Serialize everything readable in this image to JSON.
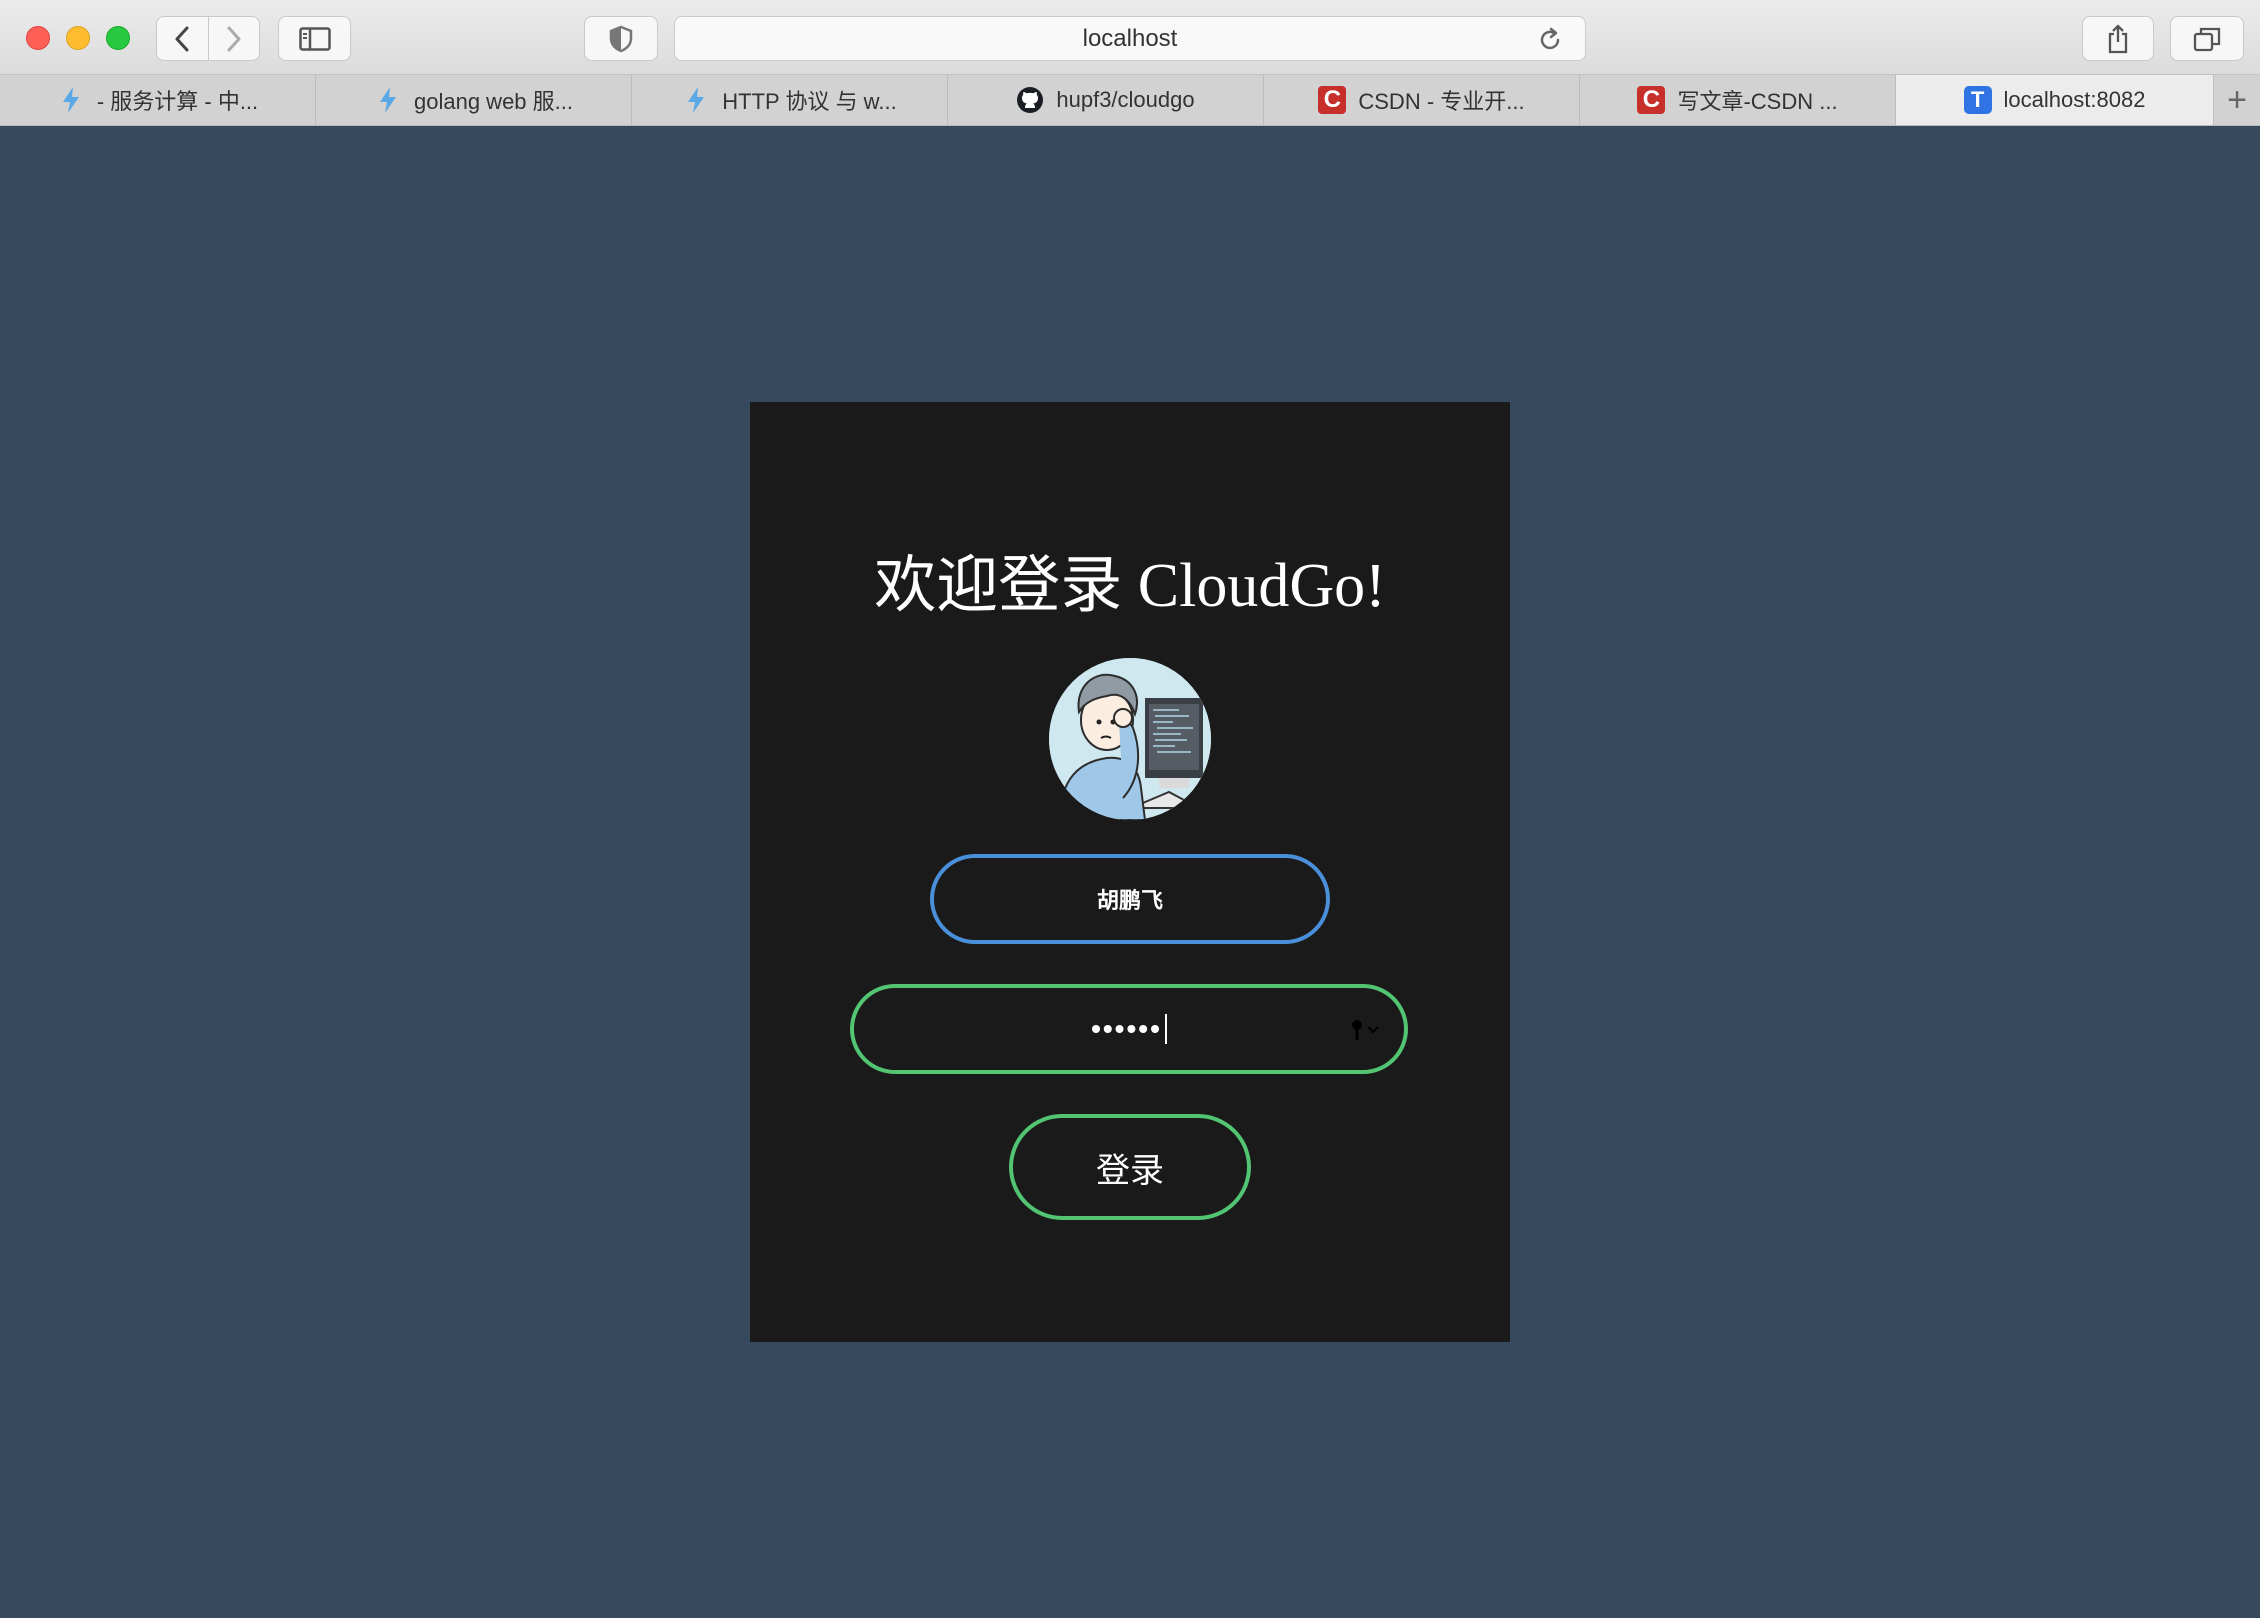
{
  "browser": {
    "url": "localhost",
    "tabs": [
      {
        "title": "- 服务计算 - 中...",
        "icon": "bolt-icon"
      },
      {
        "title": "golang web 服...",
        "icon": "bolt-icon"
      },
      {
        "title": "HTTP 协议 与 w...",
        "icon": "bolt-icon"
      },
      {
        "title": "hupf3/cloudgo",
        "icon": "github-icon"
      },
      {
        "title": "CSDN - 专业开...",
        "icon": "csdn-icon"
      },
      {
        "title": "写文章-CSDN ...",
        "icon": "csdn-icon"
      },
      {
        "title": "localhost:8082",
        "icon": "t-icon"
      }
    ],
    "new_tab": "+",
    "favicon_letters": {
      "csdn": "C",
      "t": "T"
    }
  },
  "login": {
    "title": "欢迎登录 CloudGo!",
    "username_value": "胡鹏飞",
    "password_mask": "••••••",
    "submit_label": "登录"
  },
  "colors": {
    "page_bg": "#37495c",
    "card_bg": "#1a1a1a",
    "username_border": "#4a8fd9",
    "accent_green": "#52c472"
  }
}
